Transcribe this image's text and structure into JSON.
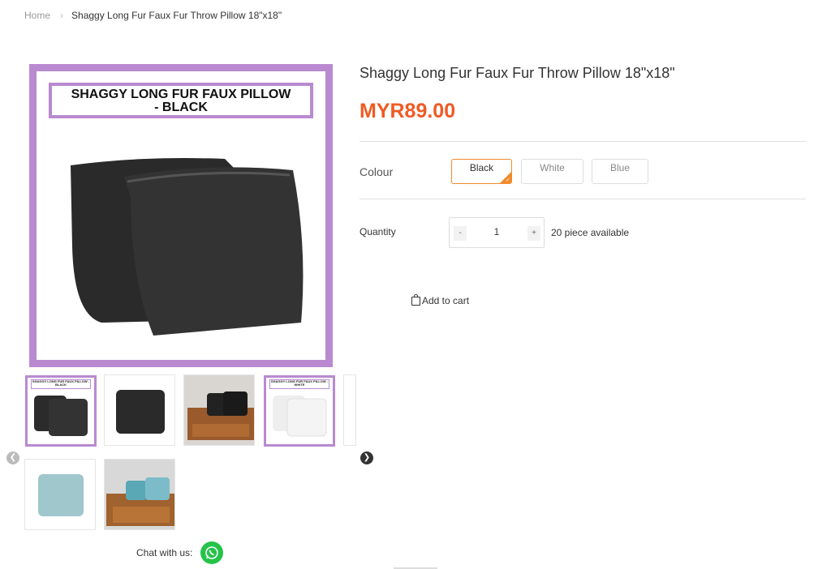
{
  "breadcrumb": {
    "home": "Home",
    "current": "Shaggy Long Fur Faux Fur Throw Pillow 18\"x18\""
  },
  "gallery": {
    "main_banner_line1": "SHAGGY LONG FUR FAUX PILLOW",
    "main_banner_line2": "- BLACK",
    "thumb_banner_black": "SHAGGY LONG FUR FAUX PILLOW - BLACK",
    "thumb_banner_white": "SHAGGY LONG FUR FAUX PILLOW - WHITE"
  },
  "product": {
    "title": "Shaggy Long Fur Faux Fur Throw Pillow 18\"x18\"",
    "price": "MYR89.00",
    "colour_label": "Colour",
    "colours": [
      "Black",
      "White",
      "Blue"
    ],
    "selected_colour": "Black",
    "quantity_label": "Quantity",
    "minus": "-",
    "plus": "+",
    "quantity": "1",
    "availability": "20 piece available",
    "add_to_cart": "Add to cart"
  },
  "chat": {
    "label": "Chat with us:"
  },
  "colors": {
    "accent": "#f05a23",
    "frame": "#b98ad0",
    "whatsapp": "#25c34a"
  }
}
